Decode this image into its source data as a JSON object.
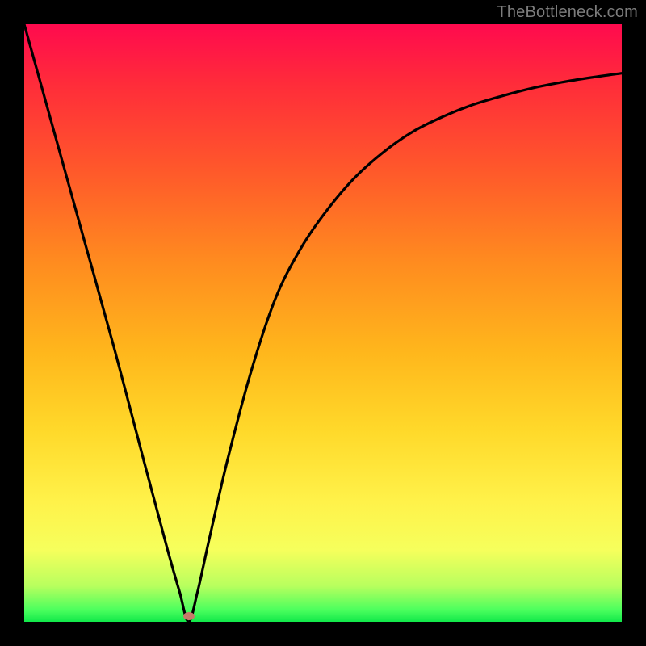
{
  "watermark": "TheBottleneck.com",
  "dot": {
    "x_pct": 27.5,
    "y_pct": 99.0
  },
  "colors": {
    "background": "#000000",
    "curve": "#000000",
    "dot": "#c77a6a",
    "gradient_top": "#ff0a4e",
    "gradient_bottom": "#11e84a"
  },
  "chart_data": {
    "type": "line",
    "title": "",
    "xlabel": "",
    "ylabel": "",
    "xlim": [
      0,
      100
    ],
    "ylim": [
      0,
      100
    ],
    "grid": false,
    "legend": false,
    "series": [
      {
        "name": "curve",
        "x": [
          0,
          5,
          10,
          15,
          20,
          24,
          26,
          27.5,
          29,
          31,
          34,
          38,
          42,
          46,
          50,
          55,
          60,
          65,
          70,
          75,
          80,
          85,
          90,
          95,
          100
        ],
        "y": [
          100,
          82,
          64,
          46,
          27,
          12,
          5,
          0,
          5,
          14,
          27,
          42,
          54,
          62,
          68,
          74,
          78.5,
          82,
          84.5,
          86.5,
          88,
          89.3,
          90.3,
          91.1,
          91.8
        ]
      }
    ],
    "markers": [
      {
        "name": "minimum-dot",
        "x": 27.5,
        "y": 0
      }
    ],
    "notes": "y-axis visually inverted: 0 at bottom (green) is the minimum of the V-shaped curve; gradient encodes y from red (high) to green (low)."
  }
}
